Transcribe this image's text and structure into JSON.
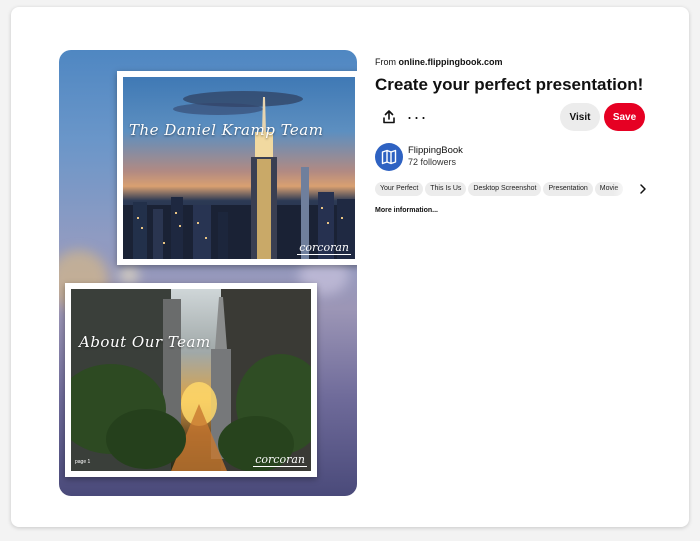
{
  "pin": {
    "photo1_title": "The Daniel Kramp Team",
    "photo1_brand": "corcoran",
    "photo2_title": "About Our Team",
    "photo2_brand": "corcoran",
    "photo2_page": "page 1"
  },
  "details": {
    "source_prefix": "From",
    "source_domain": "online.flippingbook.com",
    "title": "Create your perfect presentation!",
    "more_icon": "···",
    "visit_label": "Visit",
    "save_label": "Save"
  },
  "creator": {
    "name": "FlippingBook",
    "followers": "72 followers"
  },
  "tags": [
    "Your Perfect",
    "This Is Us",
    "Desktop Screenshot",
    "Presentation",
    "Movie"
  ],
  "more_info": "More information...",
  "icons": {
    "share": "share-icon",
    "more": "more-icon",
    "avatar": "flippingbook-logo",
    "next": "chevron-right-icon"
  },
  "colors": {
    "save": "#e60023",
    "avatar": "#2e62c2"
  }
}
